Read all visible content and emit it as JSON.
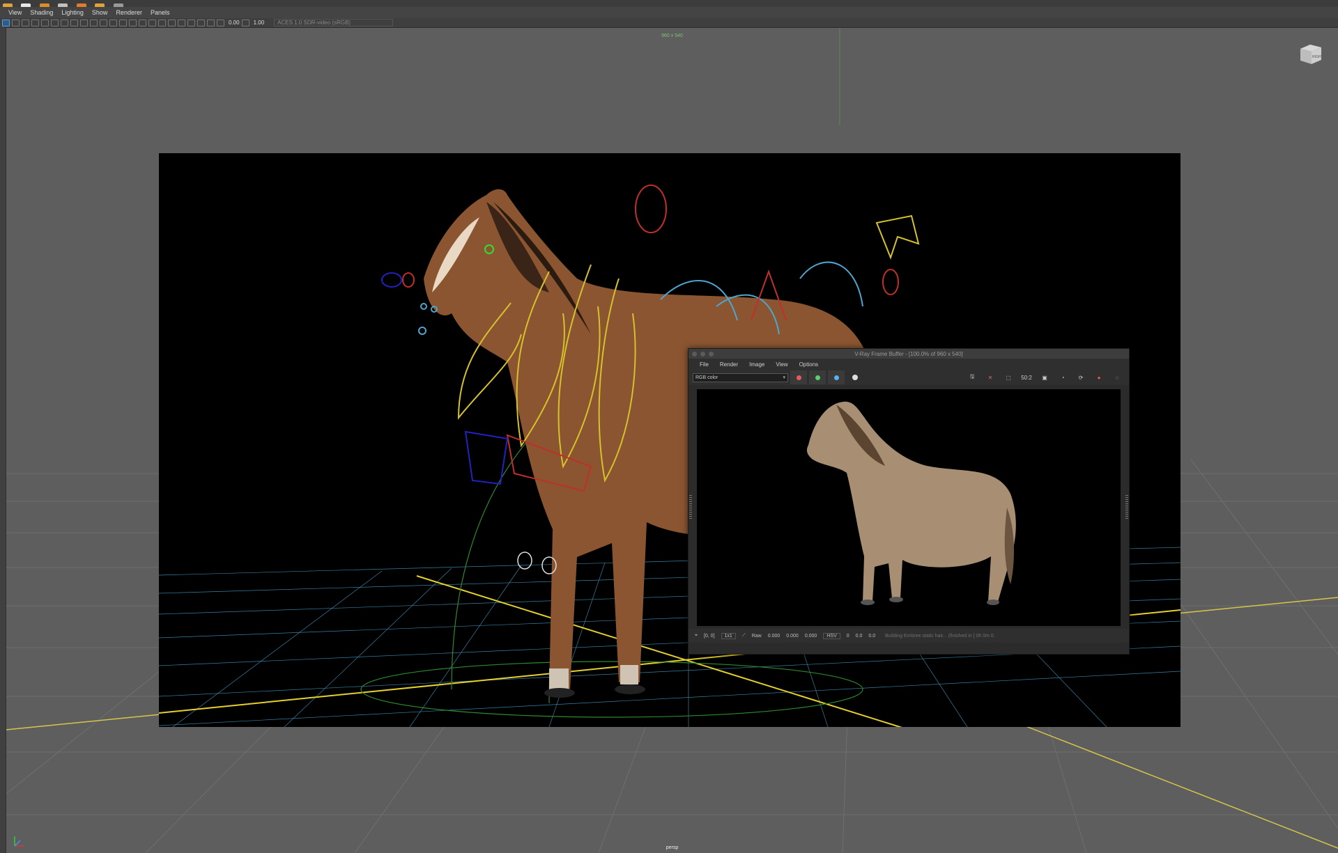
{
  "topbar": {
    "accent_colors": [
      "#e0a23a",
      "#e8e8e8",
      "#d98c2a",
      "#c0c0c0",
      "#e07b2f",
      "#e0a23a",
      "#9a9a9a"
    ]
  },
  "panel_menu": {
    "items": [
      "View",
      "Shading",
      "Lighting",
      "Show",
      "Renderer",
      "Panels"
    ]
  },
  "panel_toolbar": {
    "exposure": "0.00",
    "gamma": "1.00",
    "colorspace": "ACES 1.0 SDR-video (sRGB)"
  },
  "viewport": {
    "resolution_gate": "960 x 540",
    "camera": "persp",
    "viewcube_label": "RIGHT"
  },
  "vfb": {
    "title": "V-Ray Frame Buffer - [100.0% of 960 x 540]",
    "menu": [
      "File",
      "Render",
      "Image",
      "View",
      "Options"
    ],
    "channel": "RGB color",
    "channel_colors": {
      "red": "#e35b5b",
      "green": "#5bd16a",
      "blue": "#5bb0f0"
    },
    "toolbar_icons": [
      "save-icon",
      "clear-icon",
      "region-select-icon",
      "ratio-icon",
      "track-mouse-icon",
      "render-icon",
      "render-region-icon",
      "stop-render-icon",
      "restore-icon"
    ],
    "ratio_label": "50:2",
    "status": {
      "coords": "[0, 0]",
      "zoom": "1x1",
      "mode": "Raw",
      "r": "0.000",
      "g": "0.000",
      "b": "0.000",
      "colormode": "HSV",
      "h": "0",
      "s": "0.0",
      "v": "0.0",
      "message": "Building Embree static hair... (finished in [ 0h  0m  0."
    }
  }
}
